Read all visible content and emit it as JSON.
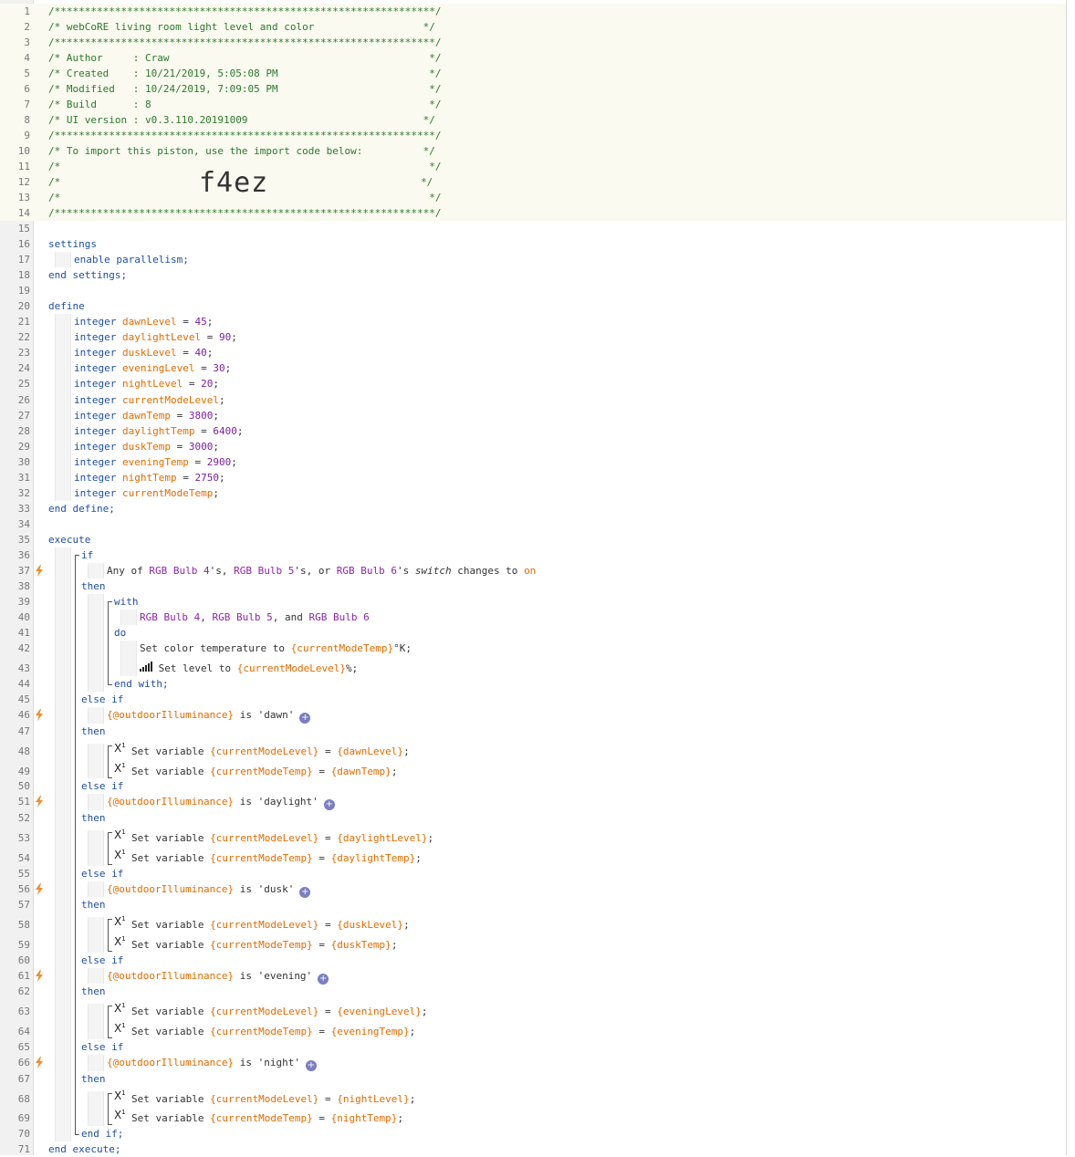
{
  "import_code": "f4ez",
  "line_numbers": [
    "1",
    "2",
    "3",
    "4",
    "5",
    "6",
    "7",
    "8",
    "9",
    "10",
    "11",
    "12",
    "13",
    "14",
    "15",
    "16",
    "17",
    "18",
    "19",
    "20",
    "21",
    "22",
    "23",
    "24",
    "25",
    "26",
    "27",
    "28",
    "29",
    "30",
    "31",
    "32",
    "33",
    "34",
    "35",
    "36",
    "37",
    "38",
    "39",
    "40",
    "41",
    "42",
    "43",
    "44",
    "45",
    "46",
    "47",
    "48",
    "49",
    "50",
    "51",
    "52",
    "53",
    "54",
    "55",
    "56",
    "57",
    "58",
    "59",
    "60",
    "61",
    "62",
    "63",
    "64",
    "65",
    "66",
    "67",
    "68",
    "69",
    "70",
    "71"
  ],
  "header": {
    "border": "/***************************************************************/",
    "title": "/* webCoRE living room light level and color                  */",
    "author": "/* Author     : Craw                                           */",
    "created": "/* Created    : 10/21/2019, 5:05:08 PM                         */",
    "modified": "/* Modified   : 10/24/2019, 7:09:05 PM                         */",
    "build": "/* Build      : 8                                              */",
    "ui_version": "/* UI version : v0.3.110.20191009                             */",
    "import_hint": "/* To import this piston, use the import code below:          */",
    "blank": "/*                                                             */",
    "code_prefix": "/*",
    "code_suffix": "*/"
  },
  "settings": {
    "open": "settings",
    "item": "enable parallelism;",
    "close": "end settings;"
  },
  "define": {
    "open": "define",
    "type": "integer",
    "vars": [
      {
        "name": "dawnLevel",
        "value": "45"
      },
      {
        "name": "daylightLevel",
        "value": "90"
      },
      {
        "name": "duskLevel",
        "value": "40"
      },
      {
        "name": "eveningLevel",
        "value": "30"
      },
      {
        "name": "nightLevel",
        "value": "20"
      },
      {
        "name": "currentModeLevel",
        "value": ""
      },
      {
        "name": "dawnTemp",
        "value": "3800"
      },
      {
        "name": "daylightTemp",
        "value": "6400"
      },
      {
        "name": "duskTemp",
        "value": "3000"
      },
      {
        "name": "eveningTemp",
        "value": "2900"
      },
      {
        "name": "nightTemp",
        "value": "2750"
      },
      {
        "name": "currentModeTemp",
        "value": ""
      }
    ],
    "close": "end define;"
  },
  "execute": {
    "open": "execute",
    "if_kw": "if",
    "then_kw": "then",
    "else_if_kw": "else if",
    "end_if": "end if;",
    "close": "end execute;",
    "trigger": {
      "any": "Any of",
      "dev1": "RGB Bulb 4",
      "dev2": "RGB Bulb 5",
      "dev3": "RGB Bulb 6",
      "poss": "'s",
      "sep1": ", ",
      "sep2": ", or ",
      "attr": "switch",
      "changes": "changes to",
      "value": "on"
    },
    "with_block": {
      "with_kw": "with",
      "devices": [
        "RGB Bulb 4",
        "RGB Bulb 5",
        "RGB Bulb 6"
      ],
      "and_kw": "and",
      "do_kw": "do",
      "cmd1_prefix": "Set color temperature to",
      "cmd1_expr": "{currentModeTemp}",
      "cmd1_suffix": "°K;",
      "cmd2_prefix": "Set level to",
      "cmd2_expr": "{currentModeLevel}",
      "cmd2_suffix": "%;",
      "end_with": "end with;"
    },
    "illuminance_var": "{@outdoorIlluminance}",
    "is_kw": "is",
    "set_var": "Set variable",
    "cases": [
      {
        "value": "'dawn'",
        "level": "{dawnLevel}",
        "temp": "{dawnTemp}"
      },
      {
        "value": "'daylight'",
        "level": "{daylightLevel}",
        "temp": "{daylightTemp}"
      },
      {
        "value": "'dusk'",
        "level": "{duskLevel}",
        "temp": "{duskTemp}"
      },
      {
        "value": "'evening'",
        "level": "{eveningLevel}",
        "temp": "{eveningTemp}"
      },
      {
        "value": "'night'",
        "level": "{nightLevel}",
        "temp": "{nightTemp}"
      }
    ],
    "target_level": "{currentModeLevel}",
    "target_temp": "{currentModeTemp}",
    "x_symbol": "X",
    "x_sup": "1",
    "plus_label": "+"
  },
  "colors": {
    "comment": "#2a7a2a",
    "keyword": "#1e4fa3",
    "variable": "#e06c00",
    "number": "#7b1fa2",
    "device": "#8e24aa",
    "bolt": "#f08c2a"
  }
}
